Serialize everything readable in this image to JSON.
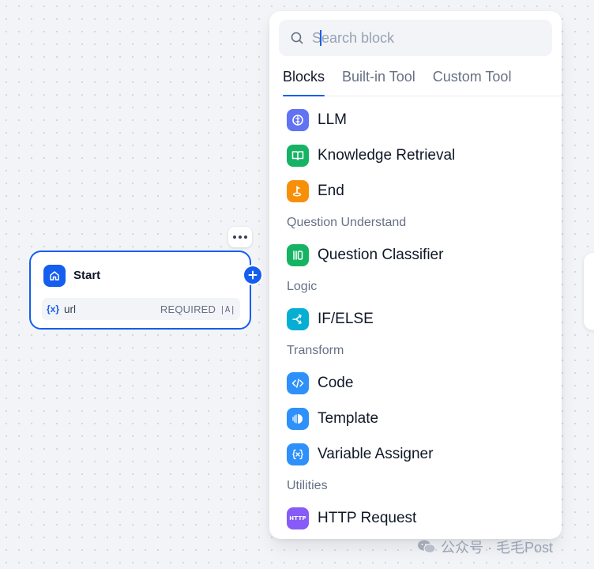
{
  "start_node": {
    "title": "Start",
    "variable": {
      "icon": "{x}",
      "name": "url",
      "required_label": "REQUIRED",
      "type_icon": "|A|"
    }
  },
  "panel": {
    "search": {
      "placeholder": "Search block",
      "value": ""
    },
    "tabs": [
      {
        "label": "Blocks",
        "active": true
      },
      {
        "label": "Built-in Tool",
        "active": false
      },
      {
        "label": "Custom Tool",
        "active": false
      }
    ],
    "items": {
      "llm": {
        "label": "LLM",
        "icon": "brain-icon",
        "color": "#6172f3"
      },
      "knowledge": {
        "label": "Knowledge Retrieval",
        "icon": "book-icon",
        "color": "#16b364"
      },
      "end": {
        "label": "End",
        "icon": "flag-icon",
        "color": "#f79009"
      },
      "classifier": {
        "label": "Question Classifier",
        "icon": "classifier-icon",
        "color": "#16b364"
      },
      "ifelse": {
        "label": "IF/ELSE",
        "icon": "branch-icon",
        "color": "#06aed4"
      },
      "code": {
        "label": "Code",
        "icon": "code-icon",
        "color": "#2e90fa"
      },
      "template": {
        "label": "Template",
        "icon": "template-icon",
        "color": "#2e90fa"
      },
      "assigner": {
        "label": "Variable Assigner",
        "icon": "variable-icon",
        "color": "#2e90fa"
      },
      "http": {
        "label": "HTTP Request",
        "icon": "http-icon",
        "icon_text": "HTTP",
        "color": "#875bf7"
      }
    },
    "sections": {
      "question": "Question Understand",
      "logic": "Logic",
      "transform": "Transform",
      "utilities": "Utilities"
    }
  },
  "watermark": "公众号 · 毛毛Post"
}
